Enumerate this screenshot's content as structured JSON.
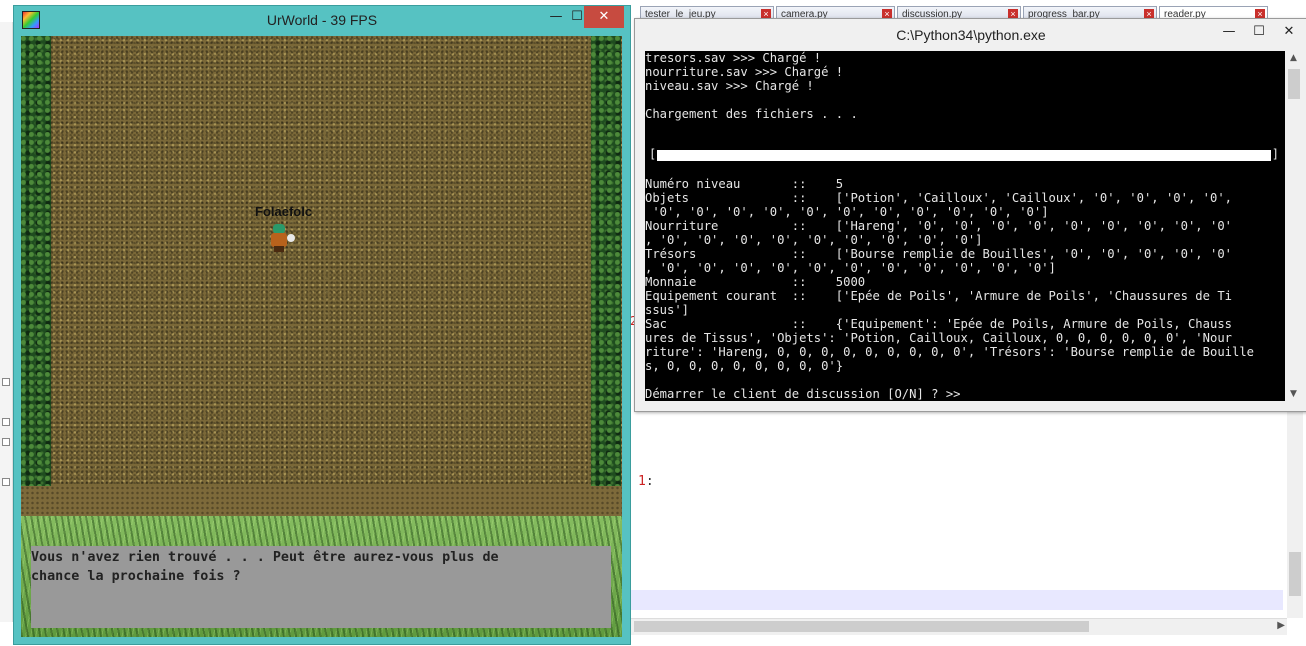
{
  "editor": {
    "tabs": [
      {
        "label": "tester_le_jeu.py",
        "active": false
      },
      {
        "label": "camera.py",
        "active": false
      },
      {
        "label": "discussion.py",
        "active": false
      },
      {
        "label": "progress_bar.py",
        "active": false
      },
      {
        "label": "reader.py",
        "active": true
      }
    ],
    "tab_close_icon": "×",
    "current_line_number": "1",
    "current_line_suffix": ":",
    "gutter_marker": "2"
  },
  "game_window": {
    "title": "UrWorld - 39 FPS",
    "minimize_glyph": "—",
    "maximize_glyph": "☐",
    "close_glyph": "✕",
    "player_name": "Folaefolc",
    "dialog": {
      "line1": "Vous n'avez rien trouvé . . . Peut être aurez-vous plus de",
      "line2": "chance la prochaine fois ?"
    }
  },
  "console_window": {
    "title": "C:\\Python34\\python.exe",
    "minimize_glyph": "—",
    "maximize_glyph": "☐",
    "close_glyph": "✕",
    "lines_top": [
      "tresors.sav >>> Chargé !",
      "nourriture.sav >>> Chargé !",
      "niveau.sav >>> Chargé !",
      "",
      "Chargement des fichiers . . .",
      "",
      ""
    ],
    "progress": {
      "open": "[",
      "close": "]",
      "fraction": 1.0
    },
    "lines_bottom": [
      "",
      "Numéro niveau       ::    5",
      "Objets              ::    ['Potion', 'Cailloux', 'Cailloux', '0', '0', '0', '0',",
      " '0', '0', '0', '0', '0', '0', '0', '0', '0', '0', '0']",
      "Nourriture          ::    ['Hareng', '0', '0', '0', '0', '0', '0', '0', '0', '0'",
      ", '0', '0', '0', '0', '0', '0', '0', '0', '0']",
      "Trésors             ::    ['Bourse remplie de Bouilles', '0', '0', '0', '0', '0'",
      ", '0', '0', '0', '0', '0', '0', '0', '0', '0', '0', '0']",
      "Monnaie             ::    5000",
      "Equipement courant  ::    ['Epée de Poils', 'Armure de Poils', 'Chaussures de Ti",
      "ssus']",
      "Sac                 ::    {'Equipement': 'Epée de Poils, Armure de Poils, Chauss",
      "ures de Tissus', 'Objets': 'Potion, Cailloux, Cailloux, 0, 0, 0, 0, 0, 0', 'Nour",
      "riture': 'Hareng, 0, 0, 0, 0, 0, 0, 0, 0, 0', 'Trésors': 'Bourse remplie de Bouille",
      "s, 0, 0, 0, 0, 0, 0, 0, 0'}",
      "",
      "Démarrer le client de discussion [O/N] ? >> "
    ]
  }
}
